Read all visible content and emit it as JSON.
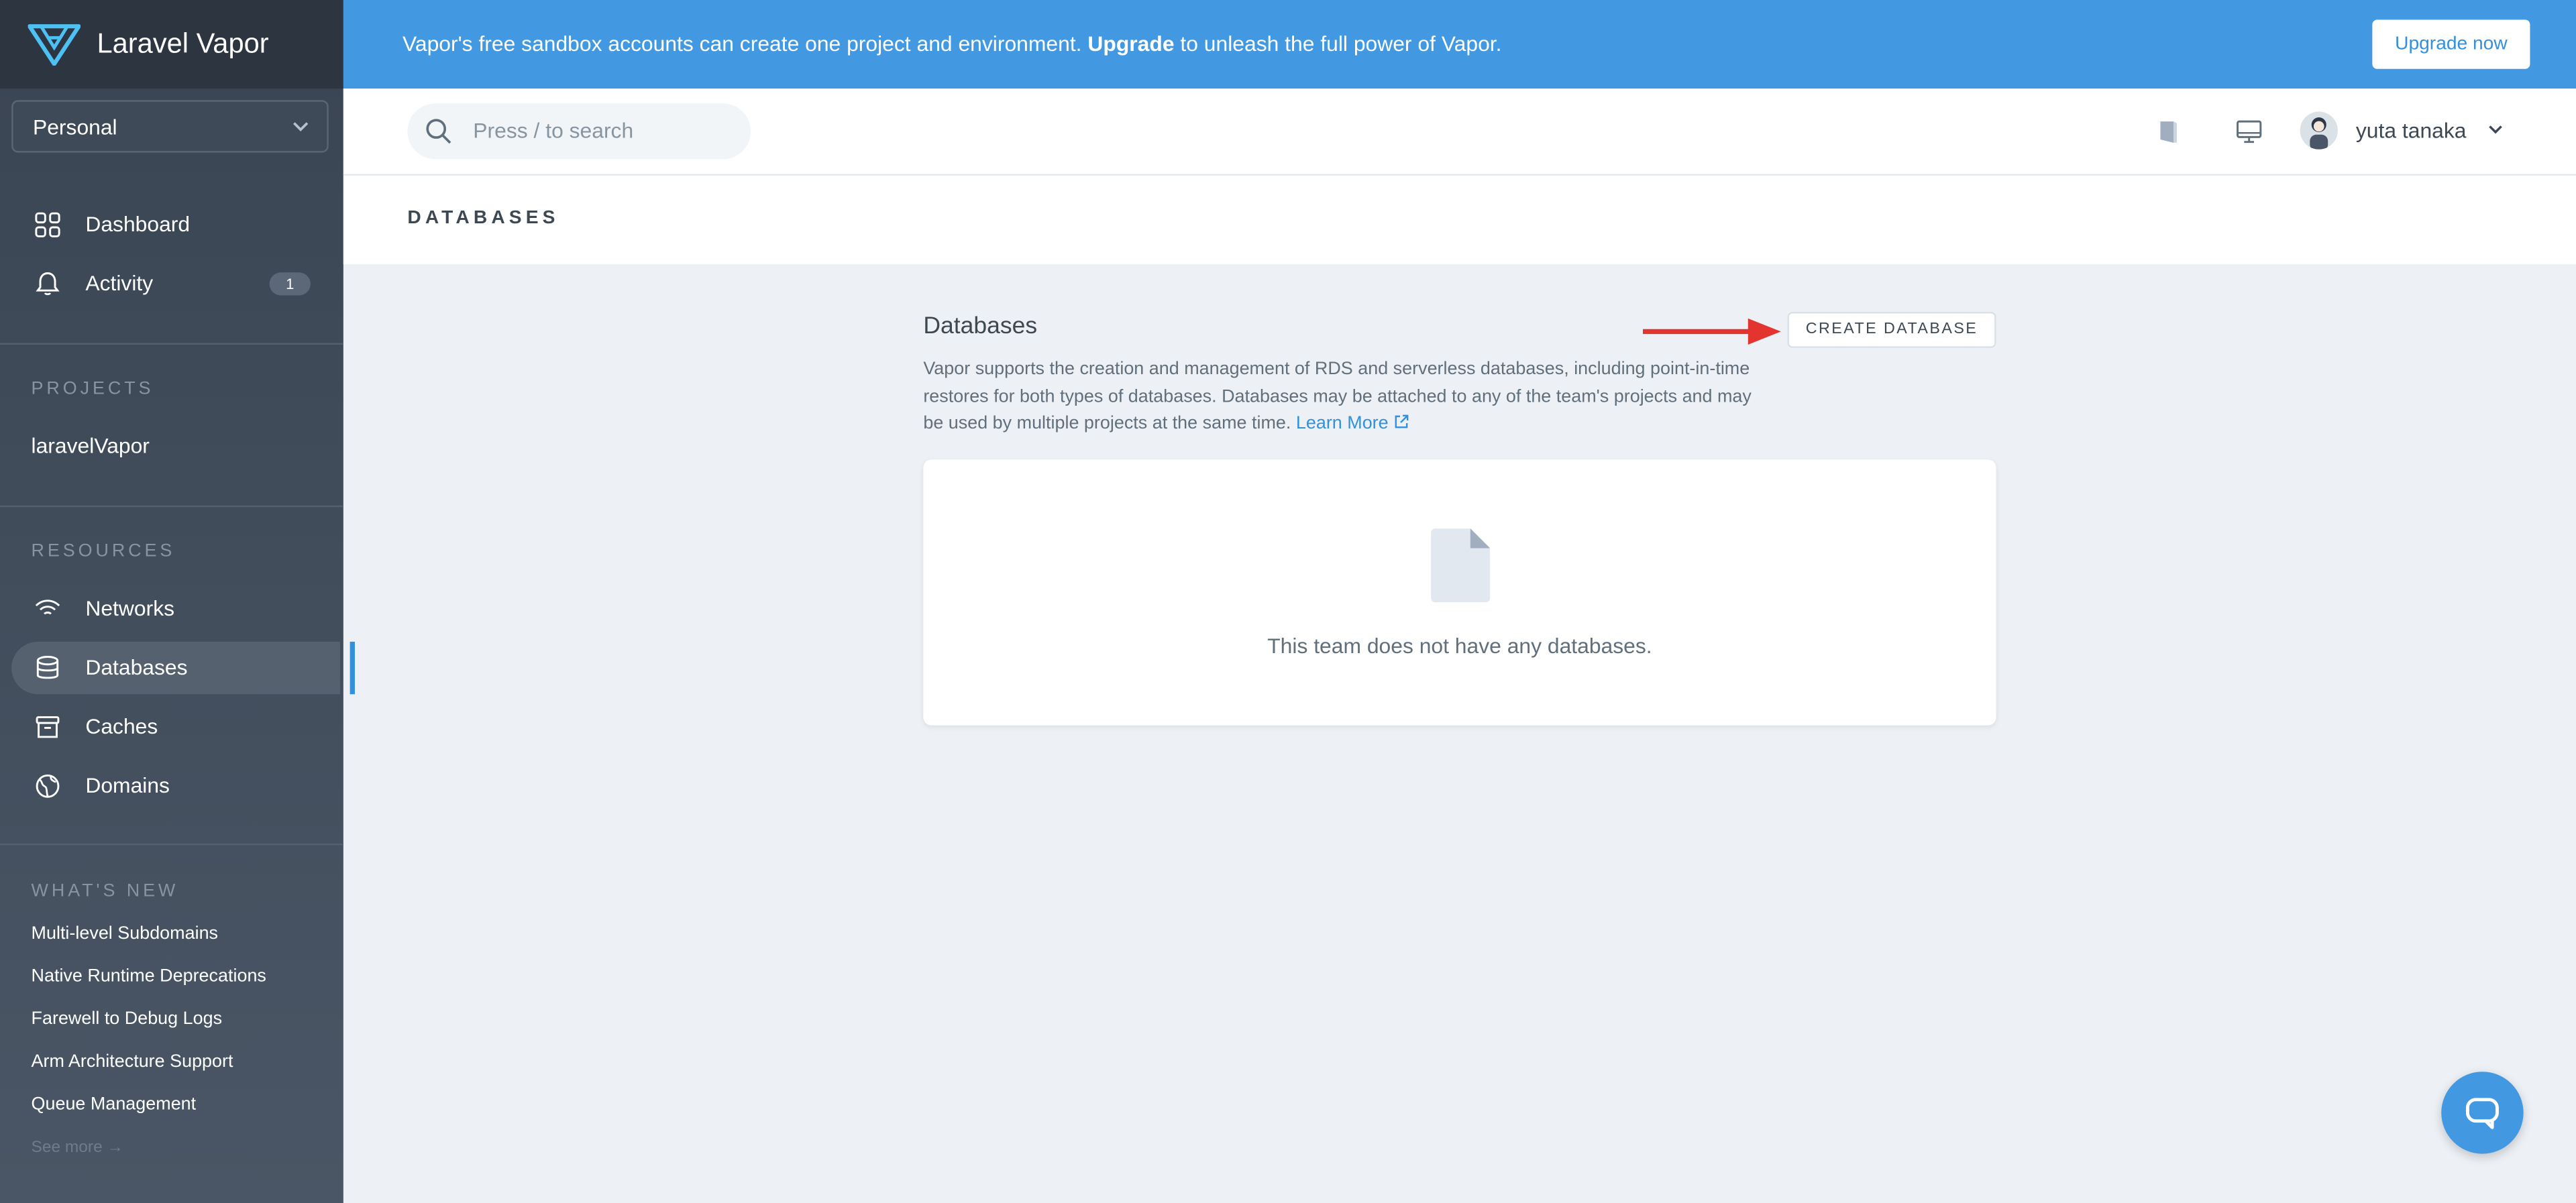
{
  "brand": {
    "name": "Laravel Vapor"
  },
  "team_select": {
    "value": "Personal"
  },
  "nav": {
    "dashboard": "Dashboard",
    "activity": "Activity",
    "activity_badge": "1"
  },
  "projects": {
    "title": "PROJECTS",
    "items": [
      "laravelVapor"
    ]
  },
  "resources": {
    "title": "RESOURCES",
    "networks": "Networks",
    "databases": "Databases",
    "caches": "Caches",
    "domains": "Domains"
  },
  "whats_new": {
    "title": "WHAT'S NEW",
    "items": [
      "Multi-level Subdomains",
      "Native Runtime Deprecations",
      "Farewell to Debug Logs",
      "Arm Architecture Support",
      "Queue Management"
    ],
    "see_more": "See more →"
  },
  "banner": {
    "text_before": "Vapor's free sandbox accounts can create one project and environment.",
    "text_bold": "Upgrade",
    "text_after": "to unleash the full power of Vapor.",
    "button": "Upgrade now"
  },
  "header": {
    "search_placeholder": "Press / to search",
    "user_name": "yuta tanaka"
  },
  "page": {
    "title": "DATABASES"
  },
  "content": {
    "title": "Databases",
    "description": "Vapor supports the creation and management of RDS and serverless databases, including point-in-time restores for both types of databases. Databases may be attached to any of the team's projects and may be used by multiple projects at the same time.",
    "learn_more": "Learn More",
    "create_button": "CREATE DATABASE",
    "empty_message": "This team does not have any databases."
  },
  "colors": {
    "accent": "#4299e1",
    "sidebar": "#3a4553",
    "arrow": "#e3342f"
  }
}
